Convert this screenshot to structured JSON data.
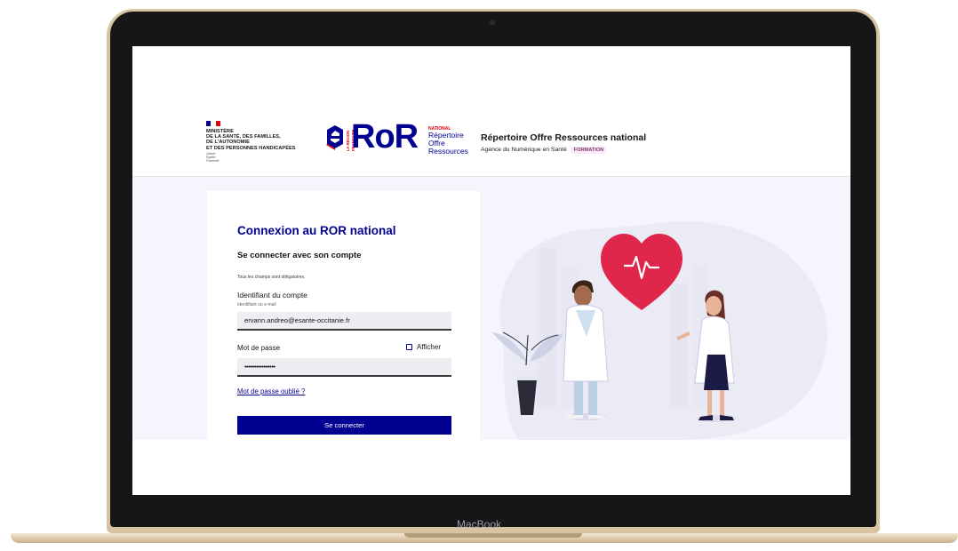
{
  "device": {
    "label": "MacBook"
  },
  "header": {
    "ministry_lines": [
      "MINISTÈRE",
      "DE LA SANTÉ, DES FAMILLES,",
      "DE L'AUTONOMIE",
      "ET DES PERSONNES HANDICAPÉES"
    ],
    "devise_lines": [
      "Liberté",
      "Égalité",
      "Fraternité"
    ],
    "logo": {
      "vertical_text": "LA RÉGION FRANÇAISE",
      "word": "RoR",
      "national": "NATIONAL",
      "sub_lines": [
        "Répertoire",
        "Offre",
        "Ressources"
      ]
    },
    "site_title": "Répertoire Offre Ressources national",
    "site_subtitle": "Agence du Numérique en Santé",
    "environment_badge": "FORMATION"
  },
  "login": {
    "title": "Connexion au ROR national",
    "subtitle": "Se connecter avec son compte",
    "required_note": "Tous les champs sont obligatoires.",
    "account_label": "Identifiant du compte",
    "account_hint": "Identifiant ou e-mail",
    "account_value": "ervann.andreo@esante-occitanie.fr",
    "password_label": "Mot de passe",
    "show_password_label": "Afficher",
    "password_value": "••••••••••••••••",
    "forgot_link": "Mot de passe oublié ?",
    "submit_label": "Se connecter"
  },
  "colors": {
    "primary": "#000091",
    "marianne_red": "#e1000f",
    "heart": "#e0264a",
    "background": "#f5f5fe",
    "badge_bg": "#fee7fc"
  },
  "icons": [
    "marianne-flag-icon",
    "ror-e-icon",
    "heartbeat-heart-icon",
    "checkbox-icon"
  ]
}
